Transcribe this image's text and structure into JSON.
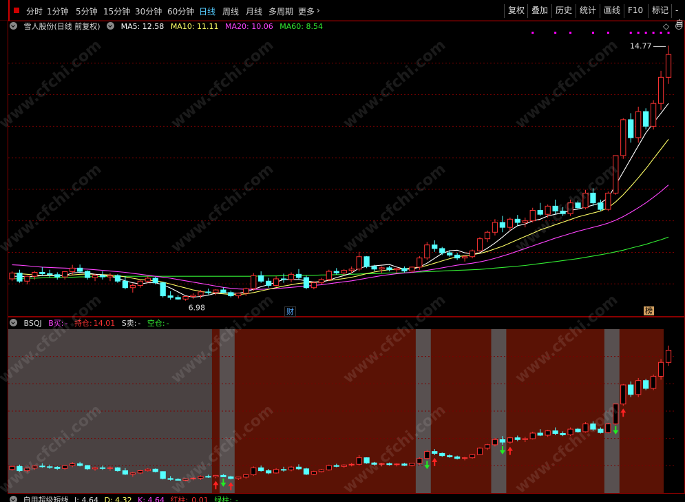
{
  "toolbar": {
    "periods": [
      "分时",
      "1分钟",
      "5分钟",
      "15分钟",
      "30分钟",
      "60分钟",
      "日线",
      "周线",
      "月线",
      "多周期",
      "更多"
    ],
    "active_period": "日线",
    "more_arrow": "›",
    "buttons": [
      "复权",
      "叠加",
      "历史",
      "统计",
      "画线",
      "F10",
      "标记",
      "-自"
    ]
  },
  "main_chart": {
    "stock_name": "雪人股份(日线 前复权)",
    "ma5_label": "MA5: 12.58",
    "ma10_label": "MA10: 11.11",
    "ma20_label": "MA20: 10.06",
    "ma60_label": "MA60: 8.54",
    "high_label": "14.77",
    "low_label": "6.98",
    "tag_cai": "财",
    "tag_bang": "榜",
    "colors": {
      "ma5": "#ffffff",
      "ma10": "#ffff66",
      "ma20": "#ff44ff",
      "ma60": "#33ee33",
      "up": "#ff3333",
      "down": "#55ffff",
      "grid": "#7a0000"
    }
  },
  "sub_chart": {
    "name": "BSQJ",
    "buy_label": "B买:",
    "buy_value": "-",
    "hold_label": "持仓:",
    "hold_value": "14.01",
    "sell_label": "S卖:",
    "sell_value": "-",
    "empty_label": "空仓:",
    "empty_value": "-",
    "colors": {
      "hold_bg": "#5a1205",
      "empty_bg": "#4a4242",
      "gap_bg": "#585050"
    }
  },
  "bottom_indicator": {
    "name": "自用超级短线",
    "j_label": "J: 4.64",
    "d_label": "D: 4.32",
    "k_label": "K: 4.64",
    "red_label": "红柱:",
    "red_value": "0.01",
    "green_label": "绿柱:",
    "green_value": "-"
  },
  "watermark": "www.cfchi.com",
  "chart_data": {
    "type": "candlestick",
    "ylim": [
      6.5,
      15.2
    ],
    "candles": [
      [
        7.62,
        7.85,
        7.55,
        7.8
      ],
      [
        7.8,
        7.9,
        7.5,
        7.55
      ],
      [
        7.55,
        7.72,
        7.45,
        7.7
      ],
      [
        7.7,
        7.86,
        7.6,
        7.82
      ],
      [
        7.82,
        7.98,
        7.72,
        7.78
      ],
      [
        7.78,
        7.9,
        7.66,
        7.75
      ],
      [
        7.75,
        7.82,
        7.6,
        7.68
      ],
      [
        7.68,
        7.86,
        7.6,
        7.84
      ],
      [
        7.84,
        8.05,
        7.75,
        7.95
      ],
      [
        7.95,
        8.06,
        7.8,
        7.85
      ],
      [
        7.85,
        7.88,
        7.6,
        7.66
      ],
      [
        7.66,
        7.78,
        7.55,
        7.72
      ],
      [
        7.72,
        7.85,
        7.6,
        7.68
      ],
      [
        7.68,
        7.8,
        7.55,
        7.72
      ],
      [
        7.72,
        7.76,
        7.5,
        7.55
      ],
      [
        7.55,
        7.7,
        7.3,
        7.35
      ],
      [
        7.35,
        7.48,
        7.2,
        7.42
      ],
      [
        7.42,
        7.6,
        7.35,
        7.55
      ],
      [
        7.55,
        7.7,
        7.5,
        7.64
      ],
      [
        7.64,
        7.68,
        7.45,
        7.5
      ],
      [
        7.5,
        7.52,
        7.05,
        7.1
      ],
      [
        7.1,
        7.24,
        6.98,
        7.05
      ],
      [
        7.05,
        7.12,
        6.98,
        7.0
      ],
      [
        7.0,
        7.1,
        6.95,
        7.08
      ],
      [
        7.08,
        7.18,
        7.0,
        7.12
      ],
      [
        7.12,
        7.28,
        7.02,
        7.22
      ],
      [
        7.22,
        7.32,
        7.14,
        7.2
      ],
      [
        7.2,
        7.3,
        7.12,
        7.28
      ],
      [
        7.28,
        7.36,
        7.18,
        7.2
      ],
      [
        7.2,
        7.26,
        7.05,
        7.1
      ],
      [
        7.1,
        7.2,
        7.02,
        7.18
      ],
      [
        7.18,
        7.35,
        7.1,
        7.32
      ],
      [
        7.32,
        7.8,
        7.25,
        7.72
      ],
      [
        7.72,
        7.85,
        7.5,
        7.55
      ],
      [
        7.55,
        7.65,
        7.35,
        7.42
      ],
      [
        7.42,
        7.7,
        7.38,
        7.62
      ],
      [
        7.62,
        7.78,
        7.5,
        7.6
      ],
      [
        7.6,
        7.82,
        7.52,
        7.76
      ],
      [
        7.76,
        7.92,
        7.6,
        7.66
      ],
      [
        7.66,
        7.72,
        7.3,
        7.35
      ],
      [
        7.35,
        7.55,
        7.3,
        7.5
      ],
      [
        7.5,
        7.65,
        7.45,
        7.6
      ],
      [
        7.6,
        7.9,
        7.55,
        7.85
      ],
      [
        7.85,
        7.95,
        7.75,
        7.8
      ],
      [
        7.8,
        7.92,
        7.72,
        7.88
      ],
      [
        7.88,
        8.0,
        7.8,
        7.92
      ],
      [
        7.92,
        8.45,
        7.85,
        8.3
      ],
      [
        8.3,
        8.32,
        7.95,
        8.0
      ],
      [
        8.0,
        8.05,
        7.85,
        7.92
      ],
      [
        7.92,
        8.0,
        7.8,
        7.96
      ],
      [
        7.96,
        8.02,
        7.85,
        7.9
      ],
      [
        7.9,
        7.98,
        7.8,
        7.94
      ],
      [
        7.94,
        8.0,
        7.82,
        7.86
      ],
      [
        7.86,
        8.0,
        7.8,
        7.98
      ],
      [
        7.98,
        8.32,
        7.9,
        8.26
      ],
      [
        8.26,
        8.75,
        8.2,
        8.66
      ],
      [
        8.66,
        8.8,
        8.45,
        8.55
      ],
      [
        8.55,
        8.6,
        8.35,
        8.42
      ],
      [
        8.42,
        8.5,
        8.3,
        8.35
      ],
      [
        8.35,
        8.42,
        8.2,
        8.26
      ],
      [
        8.26,
        8.35,
        8.15,
        8.3
      ],
      [
        8.3,
        8.52,
        8.25,
        8.48
      ],
      [
        8.48,
        8.9,
        8.45,
        8.85
      ],
      [
        8.85,
        9.1,
        8.75,
        9.05
      ],
      [
        9.05,
        9.45,
        8.95,
        9.35
      ],
      [
        9.35,
        9.55,
        9.05,
        9.2
      ],
      [
        9.2,
        9.5,
        9.1,
        9.45
      ],
      [
        9.45,
        9.58,
        9.25,
        9.35
      ],
      [
        9.35,
        9.5,
        9.2,
        9.4
      ],
      [
        9.4,
        9.8,
        9.35,
        9.72
      ],
      [
        9.72,
        9.95,
        9.55,
        9.6
      ],
      [
        9.6,
        9.9,
        9.5,
        9.85
      ],
      [
        9.85,
        10.05,
        9.6,
        9.7
      ],
      [
        9.7,
        9.82,
        9.55,
        9.62
      ],
      [
        9.62,
        10.05,
        9.55,
        9.95
      ],
      [
        9.95,
        10.02,
        9.75,
        9.8
      ],
      [
        9.8,
        10.35,
        9.75,
        10.25
      ],
      [
        10.25,
        10.4,
        9.85,
        9.95
      ],
      [
        9.95,
        10.05,
        9.7,
        9.75
      ],
      [
        9.75,
        10.3,
        9.7,
        10.25
      ],
      [
        10.25,
        11.4,
        10.2,
        11.4
      ],
      [
        11.4,
        12.55,
        11.3,
        12.5
      ],
      [
        12.5,
        12.7,
        11.8,
        11.95
      ],
      [
        11.95,
        12.9,
        11.8,
        12.75
      ],
      [
        12.75,
        12.85,
        12.2,
        12.3
      ],
      [
        12.3,
        13.1,
        12.2,
        13.0
      ],
      [
        13.0,
        14.0,
        12.8,
        13.8
      ],
      [
        13.8,
        14.77,
        13.6,
        14.5
      ]
    ],
    "ma5": [
      7.7,
      7.7,
      7.68,
      7.7,
      7.72,
      7.74,
      7.72,
      7.72,
      7.8,
      7.82,
      7.8,
      7.76,
      7.74,
      7.7,
      7.64,
      7.56,
      7.5,
      7.46,
      7.5,
      7.5,
      7.44,
      7.34,
      7.22,
      7.1,
      7.06,
      7.08,
      7.12,
      7.18,
      7.2,
      7.18,
      7.18,
      7.22,
      7.3,
      7.38,
      7.44,
      7.52,
      7.6,
      7.6,
      7.6,
      7.56,
      7.52,
      7.52,
      7.58,
      7.66,
      7.72,
      7.8,
      7.95,
      8.0,
      8.02,
      8.04,
      8.06,
      7.98,
      7.92,
      7.92,
      7.98,
      8.1,
      8.25,
      8.4,
      8.48,
      8.5,
      8.42,
      8.38,
      8.42,
      8.56,
      8.72,
      8.9,
      9.1,
      9.25,
      9.3,
      9.4,
      9.45,
      9.55,
      9.6,
      9.65,
      9.72,
      9.76,
      9.82,
      9.88,
      9.95,
      10.1,
      10.5,
      10.9,
      11.3,
      11.7,
      12.1,
      12.4,
      12.7,
      13.0
    ],
    "ma10": [
      7.8,
      7.78,
      7.76,
      7.74,
      7.72,
      7.72,
      7.72,
      7.72,
      7.74,
      7.76,
      7.77,
      7.76,
      7.75,
      7.74,
      7.72,
      7.68,
      7.64,
      7.6,
      7.58,
      7.56,
      7.52,
      7.46,
      7.4,
      7.34,
      7.28,
      7.24,
      7.2,
      7.18,
      7.16,
      7.14,
      7.14,
      7.16,
      7.2,
      7.25,
      7.3,
      7.35,
      7.4,
      7.44,
      7.48,
      7.5,
      7.52,
      7.54,
      7.57,
      7.6,
      7.63,
      7.67,
      7.72,
      7.78,
      7.83,
      7.87,
      7.9,
      7.92,
      7.93,
      7.95,
      7.98,
      8.03,
      8.1,
      8.17,
      8.24,
      8.3,
      8.33,
      8.36,
      8.4,
      8.46,
      8.54,
      8.62,
      8.72,
      8.82,
      8.92,
      9.02,
      9.12,
      9.2,
      9.28,
      9.36,
      9.44,
      9.52,
      9.58,
      9.64,
      9.7,
      9.8,
      9.98,
      10.2,
      10.45,
      10.72,
      11.0,
      11.3,
      11.6,
      11.9
    ],
    "ma20": [
      8.05,
      8.04,
      8.02,
      8.0,
      7.98,
      7.97,
      7.96,
      7.95,
      7.94,
      7.93,
      7.92,
      7.9,
      7.88,
      7.86,
      7.84,
      7.82,
      7.79,
      7.76,
      7.73,
      7.7,
      7.67,
      7.64,
      7.6,
      7.56,
      7.52,
      7.48,
      7.44,
      7.4,
      7.36,
      7.33,
      7.31,
      7.3,
      7.3,
      7.3,
      7.31,
      7.32,
      7.34,
      7.36,
      7.38,
      7.4,
      7.42,
      7.44,
      7.47,
      7.5,
      7.53,
      7.56,
      7.6,
      7.64,
      7.68,
      7.72,
      7.75,
      7.78,
      7.8,
      7.82,
      7.85,
      7.88,
      7.92,
      7.96,
      8.0,
      8.04,
      8.07,
      8.1,
      8.14,
      8.19,
      8.25,
      8.32,
      8.39,
      8.47,
      8.55,
      8.63,
      8.71,
      8.79,
      8.87,
      8.94,
      9.01,
      9.08,
      9.14,
      9.2,
      9.26,
      9.33,
      9.42,
      9.53,
      9.66,
      9.8,
      9.95,
      10.12,
      10.3,
      10.5
    ],
    "ma60": [
      7.62,
      7.63,
      7.64,
      7.64,
      7.65,
      7.66,
      7.66,
      7.67,
      7.67,
      7.68,
      7.68,
      7.69,
      7.69,
      7.69,
      7.69,
      7.7,
      7.7,
      7.7,
      7.7,
      7.7,
      7.7,
      7.7,
      7.7,
      7.7,
      7.7,
      7.7,
      7.7,
      7.7,
      7.7,
      7.7,
      7.7,
      7.7,
      7.7,
      7.71,
      7.71,
      7.71,
      7.72,
      7.72,
      7.72,
      7.73,
      7.73,
      7.74,
      7.74,
      7.75,
      7.75,
      7.76,
      7.77,
      7.78,
      7.78,
      7.79,
      7.8,
      7.8,
      7.81,
      7.82,
      7.83,
      7.84,
      7.85,
      7.86,
      7.87,
      7.88,
      7.89,
      7.9,
      7.91,
      7.93,
      7.95,
      7.97,
      7.99,
      8.01,
      8.03,
      8.06,
      8.09,
      8.12,
      8.15,
      8.18,
      8.21,
      8.24,
      8.28,
      8.32,
      8.36,
      8.4,
      8.45,
      8.5,
      8.56,
      8.62,
      8.68,
      8.75,
      8.82,
      8.9
    ],
    "buy_markers": [
      27,
      29,
      56,
      66,
      81
    ],
    "sell_markers": [
      28,
      55,
      65,
      80
    ],
    "empty_zones": [
      [
        0,
        26
      ],
      [
        28,
        29
      ],
      [
        54,
        55
      ],
      [
        64,
        65
      ],
      [
        79,
        80
      ]
    ]
  }
}
